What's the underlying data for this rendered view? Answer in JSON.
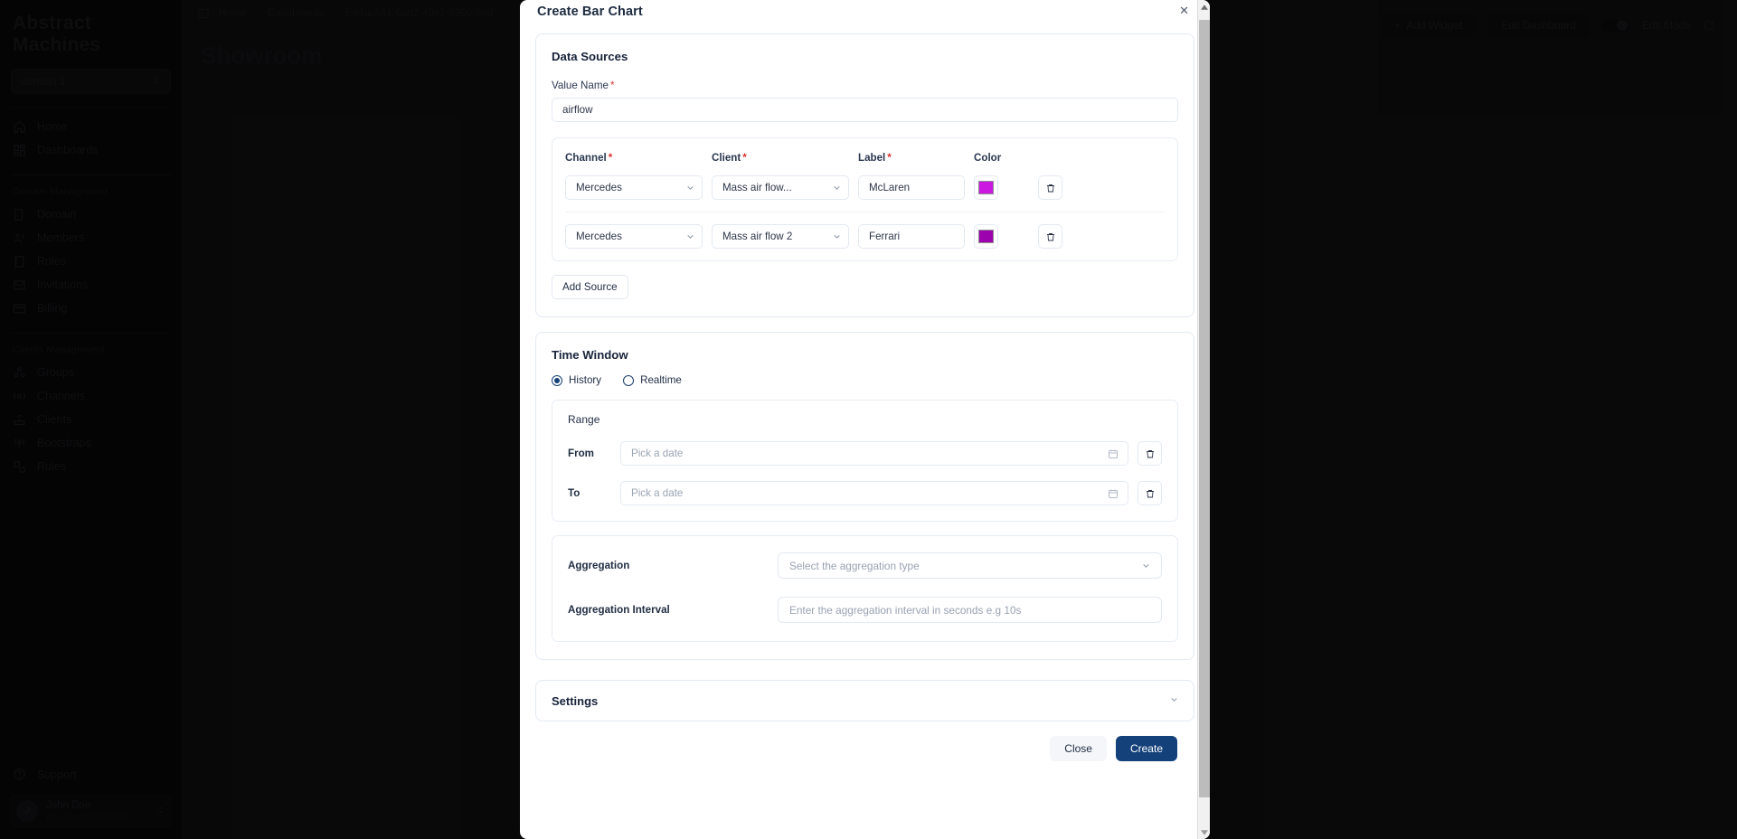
{
  "app": {
    "brand": "Abstract Machines",
    "domain_selector": "domain 1",
    "nav_primary": [
      {
        "label": "Home",
        "icon": "home-icon"
      },
      {
        "label": "Dashboards",
        "icon": "dashboards-icon"
      }
    ],
    "group_domain_title": "Domain Management",
    "nav_domain": [
      {
        "label": "Domain",
        "icon": "building-icon"
      },
      {
        "label": "Members",
        "icon": "members-icon"
      },
      {
        "label": "Roles",
        "icon": "roles-icon"
      },
      {
        "label": "Invitations",
        "icon": "envelope-icon"
      },
      {
        "label": "Billing",
        "icon": "card-icon"
      }
    ],
    "group_clients_title": "Clients Management",
    "nav_clients": [
      {
        "label": "Groups",
        "icon": "groups-icon"
      },
      {
        "label": "Channels",
        "icon": "channels-icon"
      },
      {
        "label": "Clients",
        "icon": "router-icon"
      },
      {
        "label": "Bootstraps",
        "icon": "broadcast-icon"
      },
      {
        "label": "Rules",
        "icon": "rules-icon"
      }
    ],
    "support_label": "Support",
    "user": {
      "name": "John Doe",
      "email": "john.doe@email.com",
      "initial": "J"
    },
    "breadcrumb": [
      "Home",
      "Dashboards",
      "Ee4ac561-6ad2-49e1-8950-3ed"
    ],
    "page_title": "Showroom",
    "actions": {
      "add_widget": "Add Widget",
      "edit_dashboard": "Edit Dashboard",
      "edit_mode": "Edit Mode"
    }
  },
  "modal": {
    "title": "Create Bar Chart",
    "close_icon": "✕",
    "data_sources": {
      "title": "Data Sources",
      "value_name_label": "Value Name",
      "value_name": "airflow",
      "columns": {
        "channel": "Channel",
        "client": "Client",
        "label": "Label",
        "color": "Color"
      },
      "rows": [
        {
          "channel": "Mercedes",
          "client": "Mass air flow...",
          "label": "McLaren",
          "color": "#cc19e2"
        },
        {
          "channel": "Mercedes",
          "client": "Mass air flow 2",
          "label": "Ferrari",
          "color": "#9c02ad"
        }
      ],
      "add_source_label": "Add Source"
    },
    "time_window": {
      "title": "Time Window",
      "mode_options": [
        {
          "label": "History",
          "selected": true
        },
        {
          "label": "Realtime",
          "selected": false
        }
      ],
      "range_title": "Range",
      "from_label": "From",
      "from_placeholder": "Pick a date",
      "from_value": "",
      "to_label": "To",
      "to_placeholder": "Pick a date",
      "to_value": "",
      "aggregation_label": "Aggregation",
      "aggregation_placeholder": "Select the aggregation type",
      "aggregation_value": "",
      "aggregation_interval_label": "Aggregation Interval",
      "aggregation_interval_placeholder": "Enter the aggregation interval in seconds e.g 10s",
      "aggregation_interval_value": ""
    },
    "settings": {
      "title": "Settings"
    },
    "footer": {
      "close_label": "Close",
      "create_label": "Create"
    },
    "accent_color": "#14417a"
  }
}
